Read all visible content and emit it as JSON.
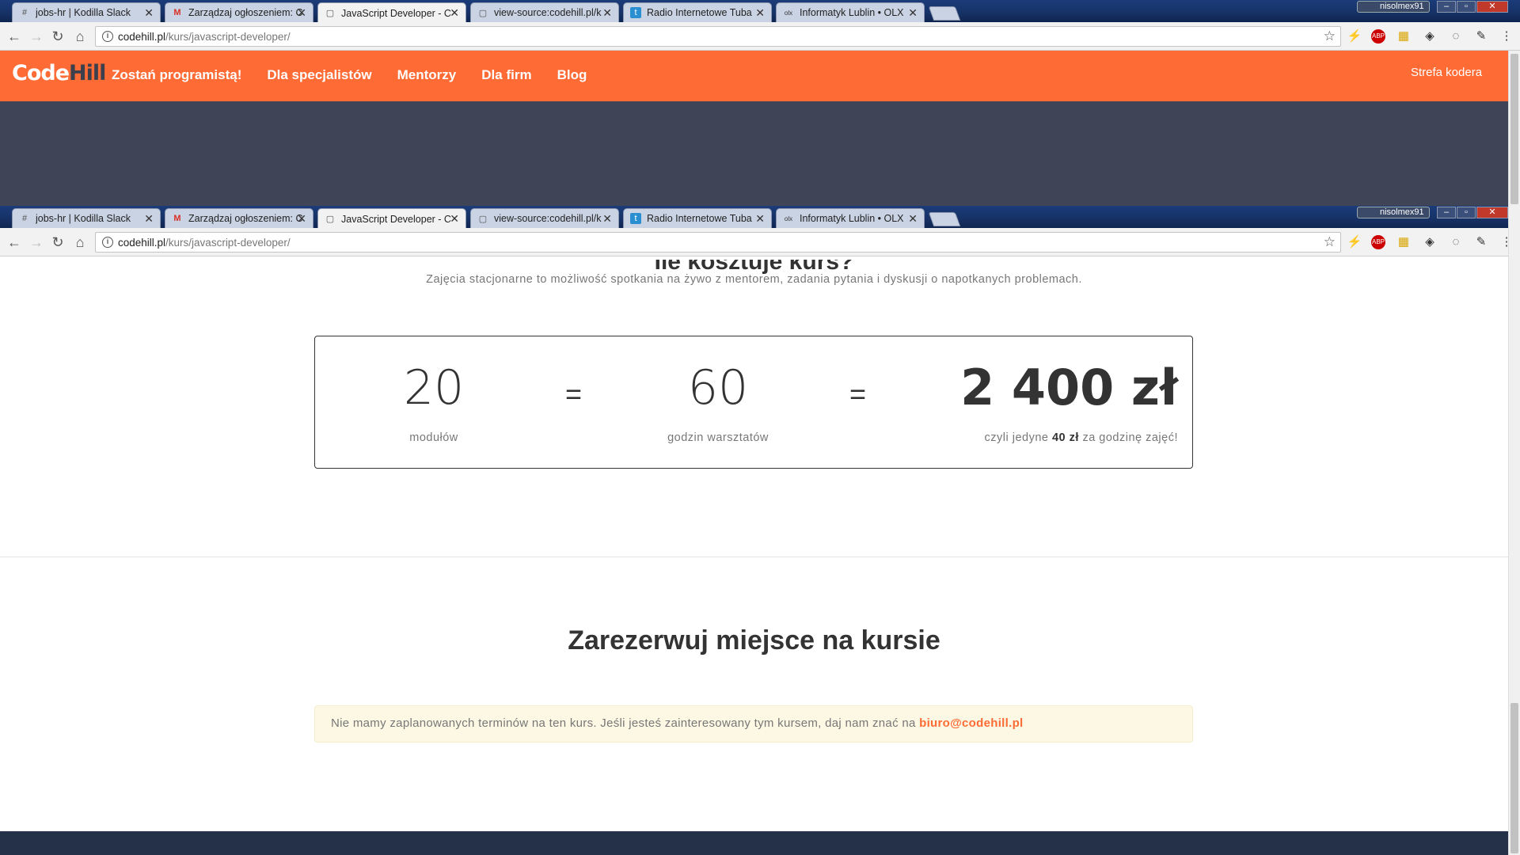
{
  "browser": {
    "tabs": [
      {
        "title": "jobs-hr | Kodilla Slack",
        "icon": "#",
        "close": "✕"
      },
      {
        "title": "Zarządzaj ogłoszeniem: C",
        "icon": "M",
        "close": "✕"
      },
      {
        "title": "JavaScript Developer - C",
        "icon": "▢",
        "close": "✕"
      },
      {
        "title": "view-source:codehill.pl/k",
        "icon": "▢",
        "close": "✕"
      },
      {
        "title": "Radio Internetowe Tuba",
        "icon": "t",
        "close": "✕"
      },
      {
        "title": "Informatyk Lublin • OLX",
        "icon": "olx",
        "close": "✕"
      }
    ],
    "profile_name": "nisolmex91",
    "url_domain": "codehill.pl",
    "url_path": "/kurs/javascript-developer/",
    "icons": {
      "back": "←",
      "forward": "→",
      "reload": "↻",
      "home": "⌂",
      "info": "i",
      "star": "☆",
      "menu": "⋮",
      "window_min": "–",
      "window_max": "▫",
      "window_close": "✕",
      "ext_bolt": "⚡",
      "ext_abp": "ABP",
      "ext_grid": "▦",
      "ext_basket": "◈",
      "ext_3": "◌",
      "ext_picker": "✎"
    }
  },
  "site": {
    "logo_code": "Code",
    "logo_hill": "Hill",
    "nav": [
      "Zostań programistą!",
      "Dla specjalistów",
      "Mentorzy",
      "Dla firm",
      "Blog"
    ],
    "strefa": "Strefa kodera",
    "brand_color": "#ff6b35"
  },
  "pricing": {
    "heading_cut": "Ile kosztuje kurs?",
    "subtitle": "Zajęcia stacjonarne to możliwość spotkania na żywo z mentorem, zadania pytania i dyskusji o napotkanych problemach.",
    "modules_value": "20",
    "modules_label": "modułów",
    "eq": "=",
    "hours_value": "60",
    "hours_label": "godzin warsztatów",
    "price_value": "2 400 zł",
    "price_label_pre": "czyli jedyne",
    "price_label_bold": "40 zł",
    "price_label_post": "za godzinę zajęć!"
  },
  "reserve": {
    "title": "Zarezerwuj miejsce na kursie",
    "alert_text": "Nie mamy zaplanowanych terminów na ten kurs. Jeśli jesteś zainteresowany tym kursem, daj nam znać na",
    "alert_email": "biuro@codehill.pl"
  }
}
